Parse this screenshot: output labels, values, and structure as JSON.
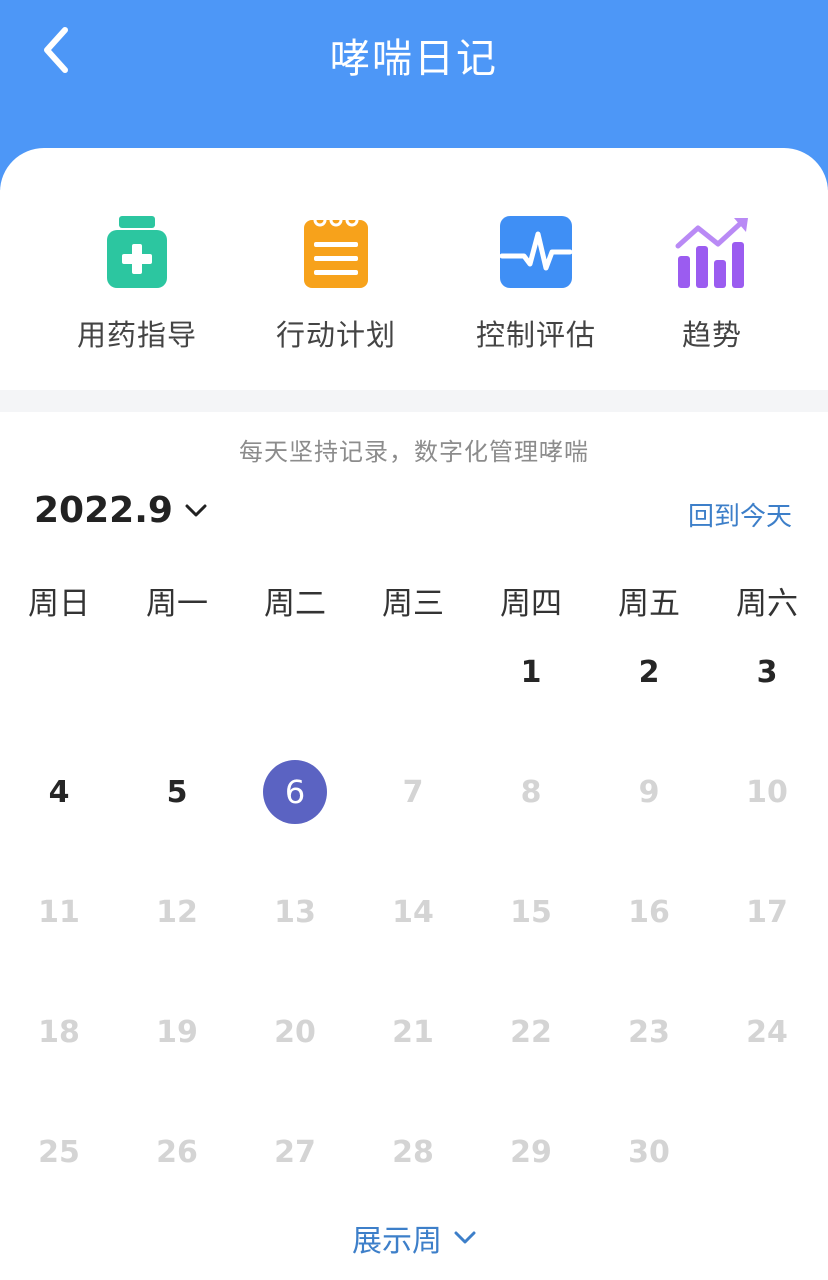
{
  "header": {
    "title": "哮喘日记"
  },
  "features": [
    {
      "label": "用药指导",
      "icon": "medicine-bottle-icon",
      "color": "#2cc6a0"
    },
    {
      "label": "行动计划",
      "icon": "notepad-icon",
      "color": "#f7a21b"
    },
    {
      "label": "控制评估",
      "icon": "pulse-chart-icon",
      "color": "#3f8ff5"
    },
    {
      "label": "趋势",
      "icon": "trend-bars-icon",
      "color": "#9b5cf0"
    }
  ],
  "calendar": {
    "slogan": "每天坚持记录，数字化管理哮喘",
    "month": "2022.9",
    "today_label": "回到今天",
    "weekdays": [
      "周日",
      "周一",
      "周二",
      "周三",
      "周四",
      "周五",
      "周六"
    ],
    "first_weekday_index": 4,
    "days_in_month": 30,
    "selected_day": 6,
    "last_active_day": 6,
    "show_week_label": "展示周"
  },
  "colors": {
    "header": "#4d97f7",
    "selected": "#5b63c2",
    "link": "#3d7fc9",
    "inactive_day": "#d4d4d4"
  }
}
